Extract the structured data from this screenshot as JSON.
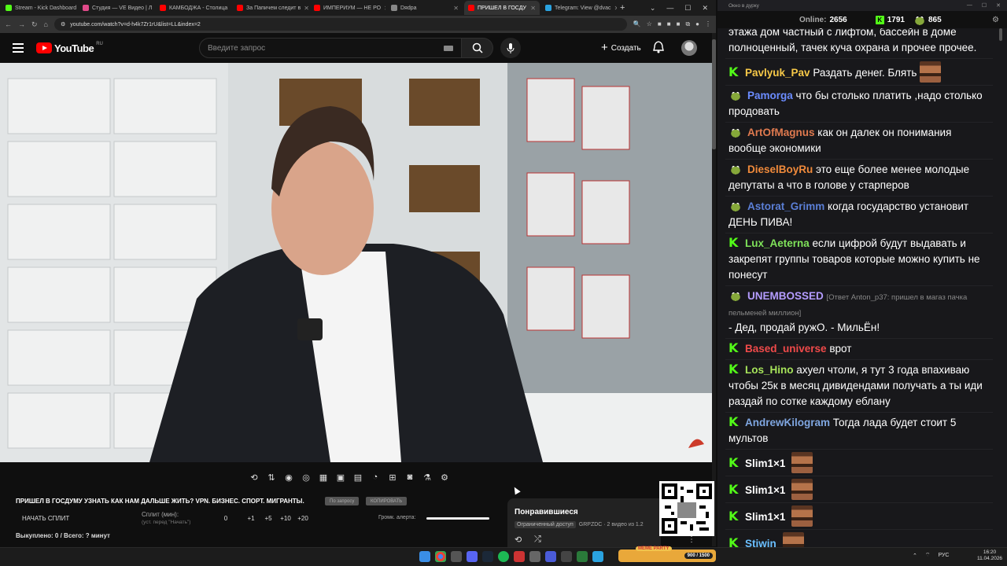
{
  "browser": {
    "tabs": [
      {
        "title": "Stream - Kick Dashboard",
        "color": "#53fc18",
        "active": false
      },
      {
        "title": "Студия — VE Видео | Л",
        "color": "#e04a8a",
        "active": false
      },
      {
        "title": "КАМБОДЖА - Столица",
        "color": "#ff0000",
        "active": false
      },
      {
        "title": "За Папичем следит в",
        "color": "#ff0000",
        "active": false
      },
      {
        "title": "ИМПЕРИУМ — НЕ РО",
        "color": "#ff0000",
        "active": false
      },
      {
        "title": "Dяdра",
        "color": "#888888",
        "active": false
      },
      {
        "title": "ПРИШЕЛ В ГОСДУ",
        "color": "#ff0000",
        "active": true
      },
      {
        "title": "Telegram: View @dvac",
        "color": "#2aa3e0",
        "active": false
      }
    ],
    "new_tab": "+",
    "url": "youtube.com/watch?v=d-h4k7Zr1rU&list=LL&index=2"
  },
  "youtube": {
    "logo_text": "YouTube",
    "region": "RU",
    "search_placeholder": "Введите запрос",
    "create_label": "Создать"
  },
  "video": {
    "title": "ПРИШЕЛ В ГОСДУМУ УЗНАТЬ КАК НАМ ДАЛЬШЕ ЖИТЬ? VPN. БИЗНЕС. СПОРТ. МИГРАНТЫ.",
    "pill_1": "По запросу",
    "pill_2": "КОПИРОВАТЬ",
    "split_button": "НАЧАТЬ СПЛИТ",
    "split_label": "Сплит (мин):",
    "split_sub": "(уст. перед \"Начать\")",
    "split_options": [
      "0",
      "+1",
      "+5",
      "+10",
      "+20"
    ],
    "volume_label": "Громк. алерта:",
    "volume_level": 1.0,
    "bought_status": "Выкуплено: 0 / Всего: ? минут"
  },
  "liked": {
    "title": "Понравившиеся",
    "access": "Ограниченный доступ",
    "meta": "GRPZDC · 2 видео из 1.2"
  },
  "chat": {
    "window_title": "Окно в дурку",
    "online_label": "Online:",
    "online_count": "2656",
    "k_count": "1791",
    "pepe_count": "865",
    "messages": [
      {
        "badge": "none",
        "user": "",
        "color": "#fff",
        "text": "этажа дом частный с лифтом, бассейн в доме полноценный, тачек куча охрана и прочее прочее.",
        "emote": false
      },
      {
        "badge": "k",
        "user": "Pavlyuk_Pav",
        "color": "#f7c948",
        "text": "Раздать денег. Блять",
        "emote": true
      },
      {
        "badge": "pepe",
        "user": "Pamorga",
        "color": "#6b8cff",
        "text": "что бы столько платить ,надо столько продовать",
        "emote": false
      },
      {
        "badge": "pepe",
        "user": "ArtOfMagnus",
        "color": "#e07a4f",
        "text": "как он далек он понимания вообще экономики",
        "emote": false
      },
      {
        "badge": "pepe",
        "user": "DieselBoyRu",
        "color": "#f08a3b",
        "text": "это еще более менее молодые депутаты а что в голове у старперов",
        "emote": false
      },
      {
        "badge": "pepe",
        "user": "Astorat_Grimm",
        "color": "#5b7fd6",
        "text": "когда государство установит ДЕНЬ ПИВА!",
        "emote": false
      },
      {
        "badge": "k",
        "user": "Lux_Aeterna",
        "color": "#7fe35a",
        "text": "если цифрой будут выдавать и закрепят группы товаров которые можно купить не понесут",
        "emote": false
      },
      {
        "badge": "pepe",
        "user": "UNEMBOSSED",
        "color": "#b49cff",
        "reply": "[Ответ Anton_p37: пришел в магаз пачка пельменей миллион]",
        "text": "- Дед, продай ружО. - МильЁн!",
        "emote": false
      },
      {
        "badge": "k",
        "user": "Based_universe",
        "color": "#f04a4a",
        "text": "врот",
        "emote": false
      },
      {
        "badge": "k",
        "user": "Los_Hino",
        "color": "#a6e35a",
        "text": "ахуел чтоли, я тут 3 года впахиваю чтобы 25к в месяц дивидендами получать а ты иди раздай по сотке каждому еблану",
        "emote": false
      },
      {
        "badge": "k",
        "user": "AndrewKilogram",
        "color": "#7fa6e0",
        "text": "Тогда лада будет стоит 5 мультов",
        "emote": false
      },
      {
        "badge": "k",
        "user": "Slim1×1",
        "color": "#ffffff",
        "text": "",
        "emote": true
      },
      {
        "badge": "k",
        "user": "Slim1×1",
        "color": "#ffffff",
        "text": "",
        "emote": true
      },
      {
        "badge": "k",
        "user": "Slim1×1",
        "color": "#ffffff",
        "text": "",
        "emote": true
      },
      {
        "badge": "k",
        "user": "Stiwin",
        "color": "#6bc0ff",
        "text": "",
        "emote": true
      }
    ]
  },
  "taskbar": {
    "meme_label": "MEME PARTY",
    "meme_progress": "900 / 1500",
    "lang": "РУС",
    "time": "16:20",
    "date": "11.04.2026"
  }
}
